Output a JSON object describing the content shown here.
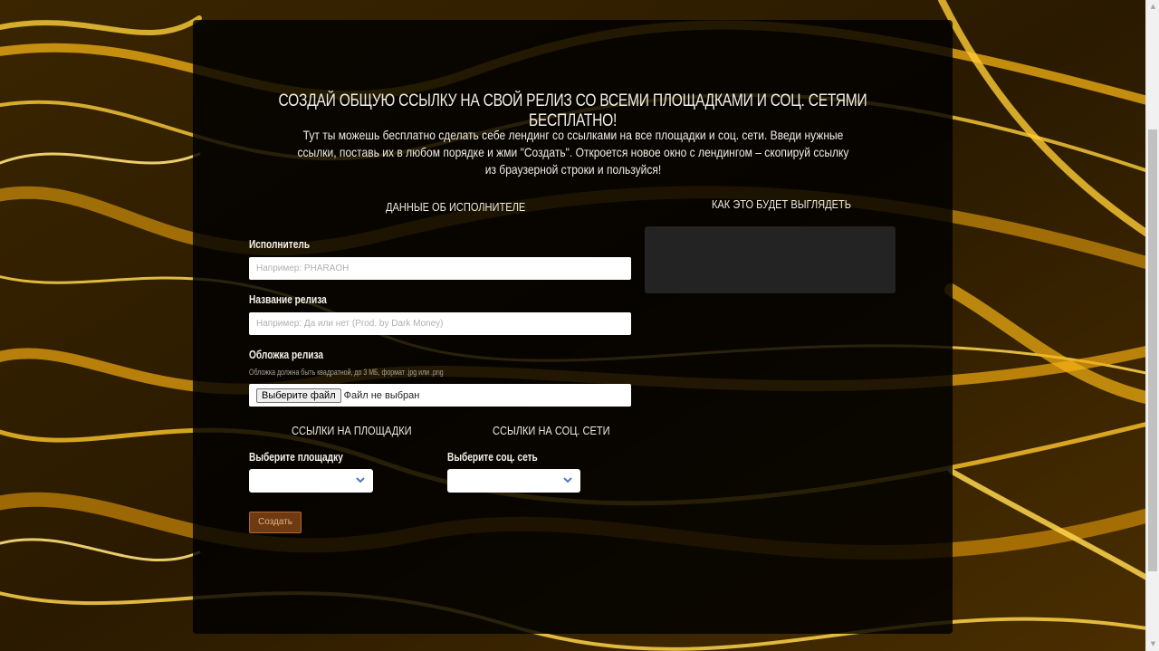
{
  "hero": {
    "title": "Создай общую ссылку на свой релиз со всеми площадками и соц. сетями бесплатно!",
    "intro": "Тут ты можешь бесплатно сделать себе лендинг со ссылками на все площадки и соц. сети. Введи нужные ссылки, поставь их в любом порядке и жми \"Создать\". Откроется новое окно с лендингом – скопируй ссылку из браузерной строки и пользуйся!"
  },
  "artist_section": {
    "heading": "Данные об исполнителе",
    "artist_label": "Исполнитель",
    "artist_placeholder": "Например: PHARAOH",
    "release_label": "Название релиза",
    "release_placeholder": "Например: Да или нет (Prod. by Dark Money)",
    "cover_label": "Обложка релиза",
    "cover_hint": "Обложка должна быть квадратной, до 3 МБ, формат .jpg или .png",
    "file_button": "Выберите файл",
    "file_status": "Файл не выбран"
  },
  "links_section": {
    "platforms_heading": "Ссылки на площадки",
    "platform_label": "Выберите площадку",
    "platform_value": "",
    "social_heading": "Ссылки на соц. сети",
    "social_label": "Выберите соц. сеть",
    "social_value": ""
  },
  "create_button": "Создать",
  "preview": {
    "heading": "Как это будет выглядеть"
  },
  "icons": {
    "select_arrow": "chevron-down-icon",
    "scroll_up": "arrow-up-icon",
    "scroll_down": "arrow-down-icon"
  },
  "colors": {
    "accent_button": "#6e3a12",
    "chevron": "#4a7dc0",
    "background_glow": "#f5b51a"
  }
}
